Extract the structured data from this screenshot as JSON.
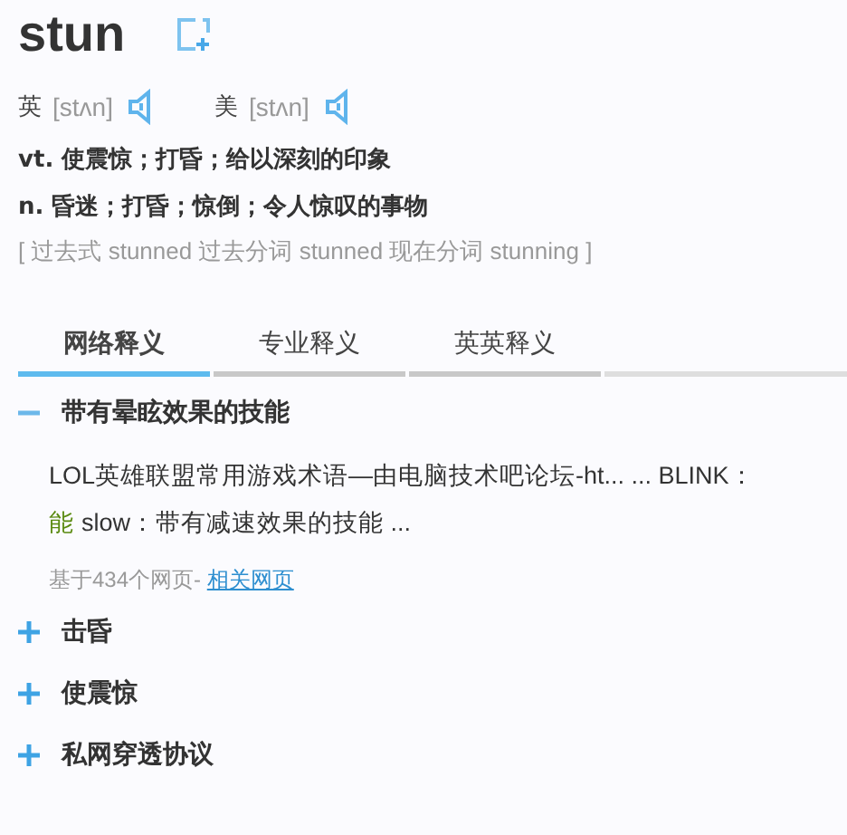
{
  "word": "stun",
  "pronunciations": [
    {
      "region": "英",
      "phonetic": "[stʌn]"
    },
    {
      "region": "美",
      "phonetic": "[stʌn]"
    }
  ],
  "definitions": [
    "vt. 使震惊；打昏；给以深刻的印象",
    "n. 昏迷；打昏；惊倒；令人惊叹的事物"
  ],
  "forms": "[ 过去式 stunned 过去分词 stunned 现在分词 stunning ]",
  "tabs": [
    {
      "label": "网络释义",
      "selected": true
    },
    {
      "label": "专业释义",
      "selected": false
    },
    {
      "label": "英英释义",
      "selected": false
    }
  ],
  "senses": [
    {
      "title": "带有晕眩效果的技能",
      "expanded": true,
      "example_line_1": "LOL英雄联盟常用游戏术语—由电脑技术吧论坛-ht... ... BLINK：",
      "highlight": "能",
      "example_line_2": "slow：带有减速效果的技能 ...",
      "source_count": "基于434个网页-",
      "source_link": "相关网页"
    },
    {
      "title": "击昏",
      "expanded": false
    },
    {
      "title": "使震惊",
      "expanded": false
    },
    {
      "title": "私网穿透协议",
      "expanded": false
    }
  ]
}
